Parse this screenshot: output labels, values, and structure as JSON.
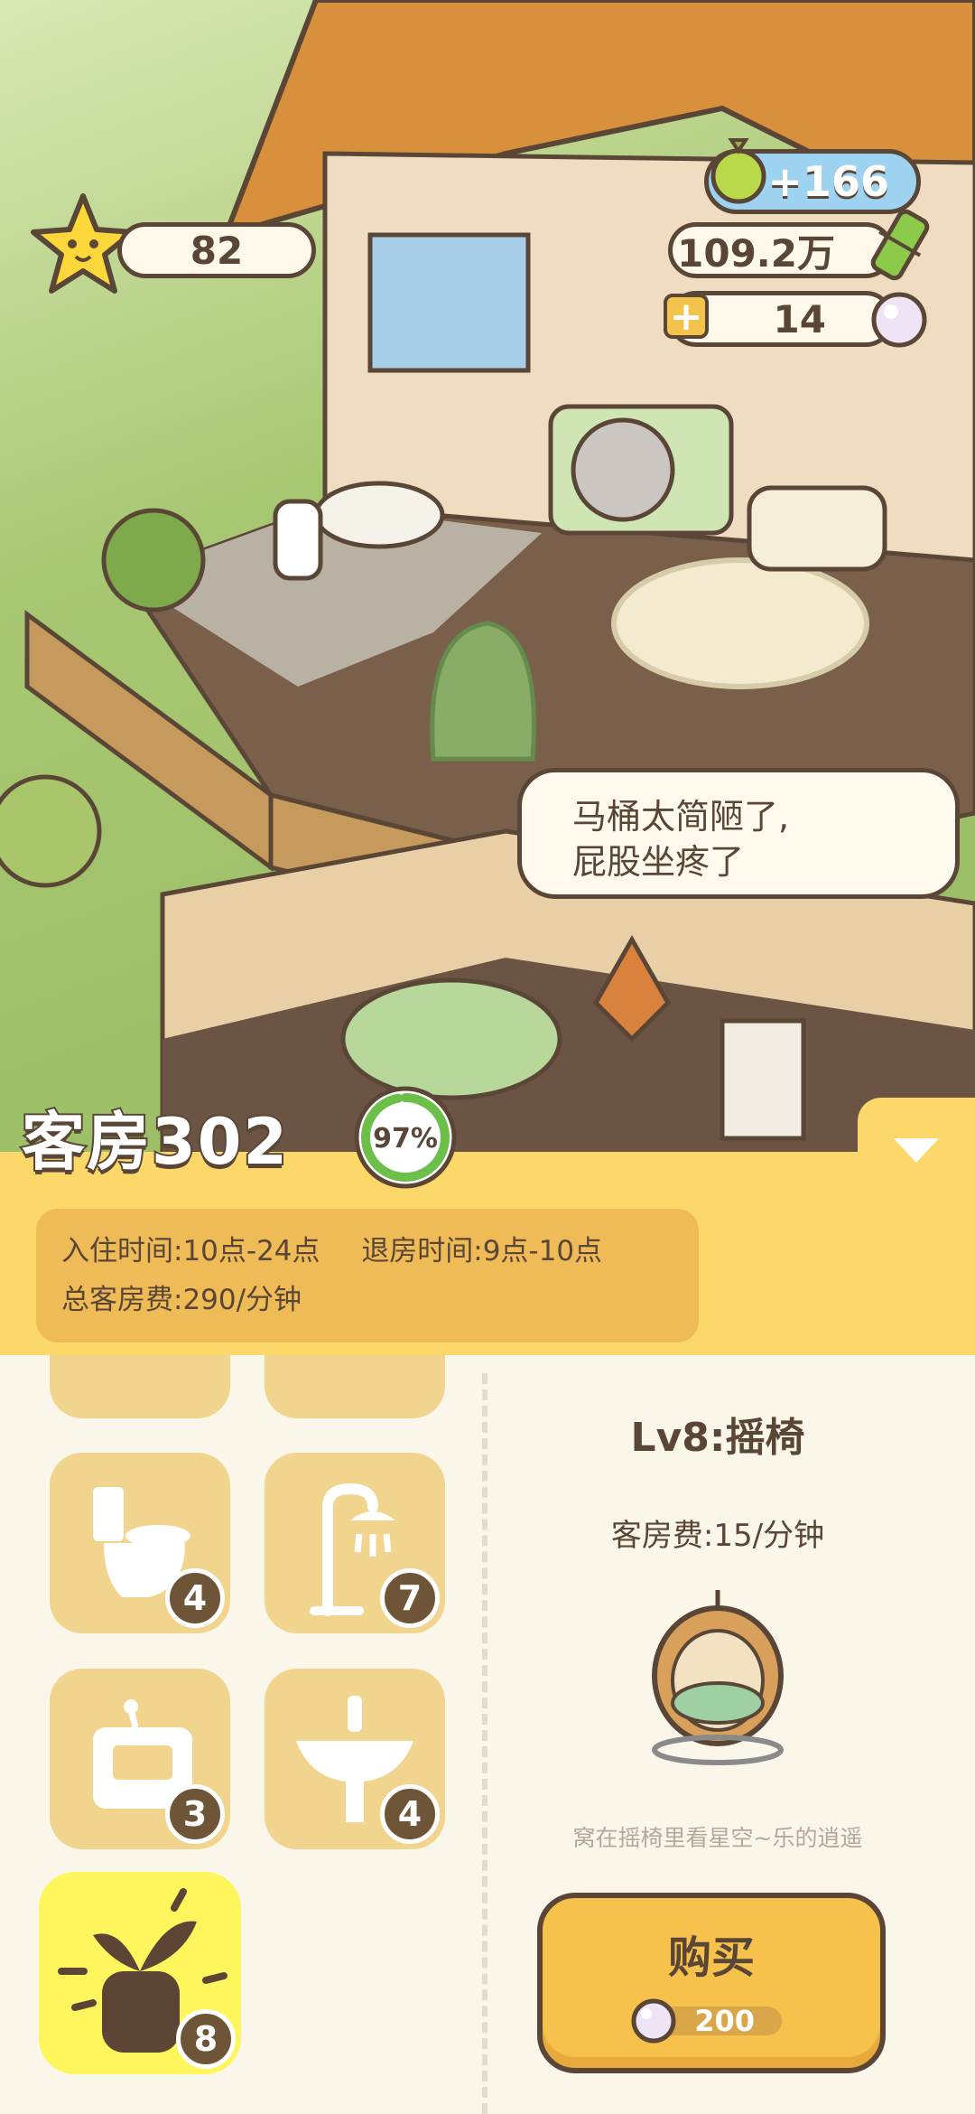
{
  "hud": {
    "stars": "82",
    "cash": "109.2万",
    "pearls": "14",
    "bonus": "+166",
    "plus_symbol": "+"
  },
  "speech": {
    "line1": "马桶太简陋了,",
    "line2": "屁股坐疼了"
  },
  "room": {
    "title": "客房302",
    "progress_label": "97%",
    "progress": 0.97,
    "checkin": "入住时间:10点-24点",
    "checkout": "退房时间:9点-10点",
    "total_fee": "总客房费:290/分钟"
  },
  "shop": {
    "items": [
      {
        "icon": "toilet-icon",
        "count": "4"
      },
      {
        "icon": "shower-icon",
        "count": "7"
      },
      {
        "icon": "cabinet-icon",
        "count": "3"
      },
      {
        "icon": "sink-icon",
        "count": "4"
      },
      {
        "icon": "sprout-icon",
        "count": "8"
      }
    ],
    "detail": {
      "name": "Lv8:摇椅",
      "fee": "客房费:15/分钟",
      "desc": "窝在摇椅里看星空~乐的逍遥",
      "buy_label": "购买",
      "price": "200"
    }
  },
  "colors": {
    "panel_yellow": "#fcd86a",
    "info_box": "#efbb56",
    "tile": "#f1d58f",
    "tile_selected": "#fff55c",
    "text_brown": "#5a4636",
    "progress_green": "#6cc04a"
  }
}
